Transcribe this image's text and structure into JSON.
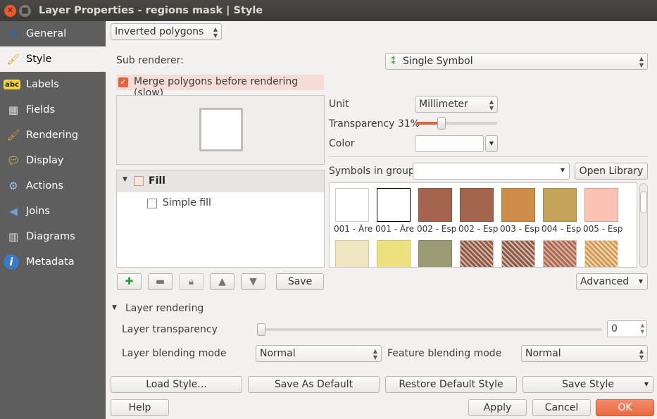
{
  "window": {
    "title": "Layer Properties - regions mask | Style"
  },
  "sidebar": {
    "items": [
      {
        "label": "General",
        "icon": "tools-icon"
      },
      {
        "label": "Style",
        "icon": "paintbrush-icon",
        "selected": true
      },
      {
        "label": "Labels",
        "icon": "abc-label-icon"
      },
      {
        "label": "Fields",
        "icon": "table-icon"
      },
      {
        "label": "Rendering",
        "icon": "brush-icon"
      },
      {
        "label": "Display",
        "icon": "speech-bubble-icon"
      },
      {
        "label": "Actions",
        "icon": "gear-icon"
      },
      {
        "label": "Joins",
        "icon": "join-icon"
      },
      {
        "label": "Diagrams",
        "icon": "chart-icon"
      },
      {
        "label": "Metadata",
        "icon": "info-icon"
      }
    ]
  },
  "renderer": {
    "value": "Inverted polygons",
    "sub_renderer_label": "Sub renderer:",
    "sub_renderer_value": "Single Symbol",
    "merge_label": "Merge polygons before rendering (slow)",
    "merge_checked": true
  },
  "symbol_tree": {
    "fill": "Fill",
    "simple_fill": "Simple fill",
    "save": "Save"
  },
  "props": {
    "unit_label": "Unit",
    "unit_value": "Millimeter",
    "transparency_label": "Transparency 31%",
    "transparency": 31,
    "color_label": "Color",
    "color": "#ffffff"
  },
  "library": {
    "group_label": "Symbols in group",
    "group_value": "",
    "open_library": "Open Library",
    "advanced": "Advanced",
    "symbols": [
      {
        "label": "001 - Áre",
        "color": "#ffffff",
        "border": "#cccccc"
      },
      {
        "label": "001 - Áre",
        "color": "#ffffff",
        "border": "#000000"
      },
      {
        "label": "002 - Esp",
        "color": "#a4644e",
        "border": "#8c4f3a"
      },
      {
        "label": "002 - Esp",
        "color": "#a4644e",
        "border": "#8c4f3a"
      },
      {
        "label": "003 - Esp",
        "color": "#cd8e4c",
        "border": "#b0753a"
      },
      {
        "label": "004 - Esp",
        "color": "#c4a45a",
        "border": "#a88b44"
      },
      {
        "label": "005 - Esp",
        "color": "#fcc2b4",
        "border": "#e0a090"
      },
      {
        "label": "",
        "color": "#ede6c0",
        "border": "#d6cc9c"
      },
      {
        "label": "",
        "color": "#ece17e",
        "border": "#d3c763"
      },
      {
        "label": "",
        "color": "#9a9a74",
        "border": "#85855f"
      },
      {
        "label": "",
        "color": "#8c5a48",
        "border": "#d8b8a8",
        "hatch": true
      },
      {
        "label": "",
        "color": "#8c5a48",
        "border": "#d8c0b0",
        "hatch": true
      },
      {
        "label": "",
        "color": "#a86a55",
        "border": "#e0b8a8",
        "hatch": true
      },
      {
        "label": "",
        "color": "#d19a55",
        "border": "#f5dcb8",
        "hatch": true
      }
    ]
  },
  "layer_rendering": {
    "title": "Layer rendering",
    "transparency_label": "Layer transparency",
    "transparency_value": "0",
    "blending_label": "Layer blending mode",
    "blending_value": "Normal",
    "feature_blending_label": "Feature blending mode",
    "feature_blending_value": "Normal"
  },
  "buttons": {
    "load_style": "Load Style...",
    "save_default": "Save As Default",
    "restore_default": "Restore Default Style",
    "save_style": "Save Style",
    "help": "Help",
    "apply": "Apply",
    "cancel": "Cancel",
    "ok": "OK"
  }
}
